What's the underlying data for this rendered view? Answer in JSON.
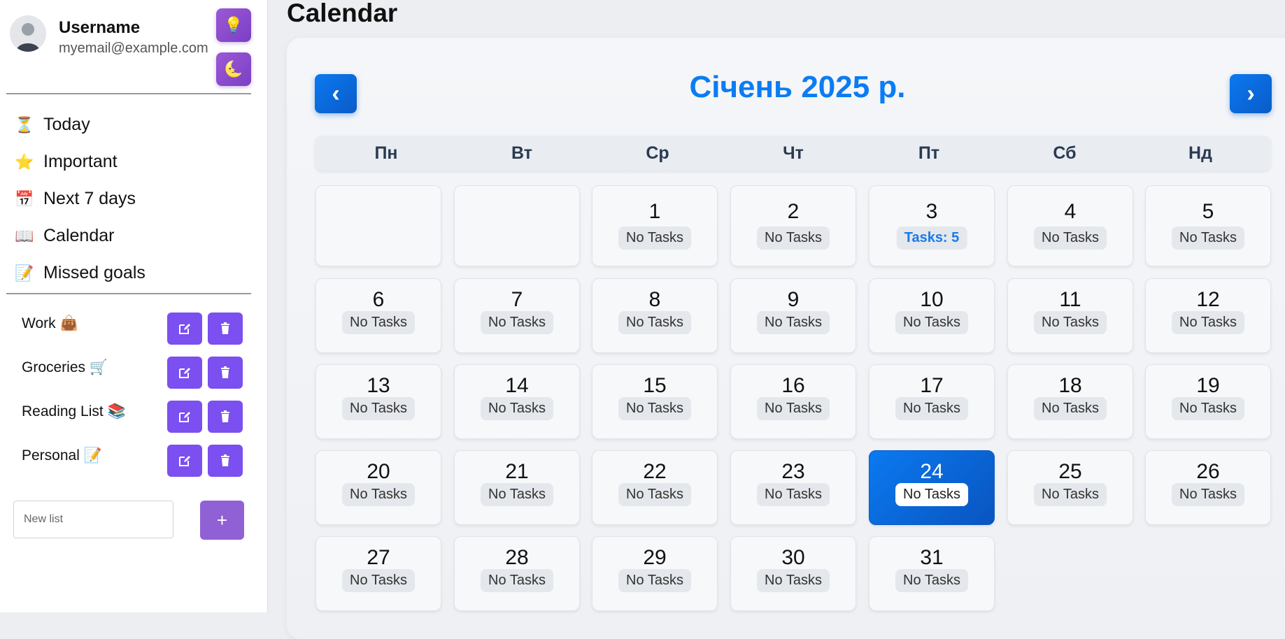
{
  "profile": {
    "username": "Username",
    "email": "myemail@example.com"
  },
  "theme_buttons": {
    "light_icon": "💡",
    "dark_icon": "🌜"
  },
  "nav": [
    {
      "icon": "⏳",
      "label": "Today"
    },
    {
      "icon": "⭐",
      "label": "Important"
    },
    {
      "icon": "📅",
      "label": "Next 7 days"
    },
    {
      "icon": "📖",
      "label": "Calendar"
    },
    {
      "icon": "📝",
      "label": "Missed goals"
    }
  ],
  "lists": [
    {
      "label": "Work 👜"
    },
    {
      "label": "Groceries 🛒"
    },
    {
      "label": "Reading List 📚"
    },
    {
      "label": "Personal 📝"
    }
  ],
  "new_list": {
    "placeholder": "New list",
    "add_label": "+"
  },
  "page_title": "Calendar",
  "calendar": {
    "month_title": "Січень 2025 р.",
    "prev_label": "‹",
    "next_label": "›",
    "weekdays": [
      "Пн",
      "Вт",
      "Ср",
      "Чт",
      "Пт",
      "Сб",
      "Нд"
    ],
    "leading_blank_days": 2,
    "today": 24,
    "days": [
      {
        "day": "1",
        "tasks": "No Tasks"
      },
      {
        "day": "2",
        "tasks": "No Tasks"
      },
      {
        "day": "3",
        "tasks": "Tasks: 5"
      },
      {
        "day": "4",
        "tasks": "No Tasks"
      },
      {
        "day": "5",
        "tasks": "No Tasks"
      },
      {
        "day": "6",
        "tasks": "No Tasks"
      },
      {
        "day": "7",
        "tasks": "No Tasks"
      },
      {
        "day": "8",
        "tasks": "No Tasks"
      },
      {
        "day": "9",
        "tasks": "No Tasks"
      },
      {
        "day": "10",
        "tasks": "No Tasks"
      },
      {
        "day": "11",
        "tasks": "No Tasks"
      },
      {
        "day": "12",
        "tasks": "No Tasks"
      },
      {
        "day": "13",
        "tasks": "No Tasks"
      },
      {
        "day": "14",
        "tasks": "No Tasks"
      },
      {
        "day": "15",
        "tasks": "No Tasks"
      },
      {
        "day": "16",
        "tasks": "No Tasks"
      },
      {
        "day": "17",
        "tasks": "No Tasks"
      },
      {
        "day": "18",
        "tasks": "No Tasks"
      },
      {
        "day": "19",
        "tasks": "No Tasks"
      },
      {
        "day": "20",
        "tasks": "No Tasks"
      },
      {
        "day": "21",
        "tasks": "No Tasks"
      },
      {
        "day": "22",
        "tasks": "No Tasks"
      },
      {
        "day": "23",
        "tasks": "No Tasks"
      },
      {
        "day": "24",
        "tasks": "No Tasks"
      },
      {
        "day": "25",
        "tasks": "No Tasks"
      },
      {
        "day": "26",
        "tasks": "No Tasks"
      },
      {
        "day": "27",
        "tasks": "No Tasks"
      },
      {
        "day": "28",
        "tasks": "No Tasks"
      },
      {
        "day": "29",
        "tasks": "No Tasks"
      },
      {
        "day": "30",
        "tasks": "No Tasks"
      },
      {
        "day": "31",
        "tasks": "No Tasks"
      }
    ]
  },
  "colors": {
    "accent": "#0b7cf3",
    "list_button": "#7b4ff0",
    "theme_button": "#8a4dd0",
    "add_button": "#9061d4"
  }
}
